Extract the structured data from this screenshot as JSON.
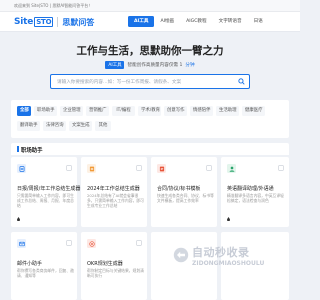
{
  "topbar": {
    "welcome": "欢迎来到 Site|STO | 思默AI智能问答平台！"
  },
  "brand": {
    "logo_en_1": "Site",
    "logo_en_2": "STO",
    "logo_cn": "思默问答"
  },
  "nav": {
    "items": [
      {
        "label": "AI工具",
        "active": true
      },
      {
        "label": "AI绘画",
        "active": false
      },
      {
        "label": "AIGC教程",
        "active": false
      },
      {
        "label": "文字转语音",
        "active": false
      },
      {
        "label": "日语",
        "active": false
      }
    ]
  },
  "hero": {
    "title": "工作与生活，思默助你一臂之力",
    "tag": "AI工具",
    "subtitle": "智能创作高质量内容仅需 1",
    "subtitle_link": "分钟"
  },
  "search": {
    "placeholder": "请输入你要搜索的内容…如：写一份工作周报、请假条、文案"
  },
  "categories": [
    {
      "label": "全部",
      "active": true
    },
    {
      "label": "职场助手",
      "active": false
    },
    {
      "label": "企业管理",
      "active": false
    },
    {
      "label": "营销推广",
      "active": false
    },
    {
      "label": "IT/编程",
      "active": false
    },
    {
      "label": "学术/教育",
      "active": false
    },
    {
      "label": "创意写作",
      "active": false
    },
    {
      "label": "情感陪伴",
      "active": false
    },
    {
      "label": "生活助理",
      "active": false
    },
    {
      "label": "健康医疗",
      "active": false
    },
    {
      "label": "翻译助手",
      "active": false
    },
    {
      "label": "法律咨询",
      "active": false
    },
    {
      "label": "文案生成",
      "active": false
    },
    {
      "label": "其他",
      "active": false
    }
  ],
  "section": {
    "title": "职场助手"
  },
  "cards": [
    {
      "name": "日报/周报/年工作总结生成器",
      "desc": "只需要简单输入工作内容，即可生成工作总结、周报、月报、年度总结",
      "icon": "report-icon",
      "color": "#1a73e8"
    },
    {
      "name": "2024年工作总结生成器",
      "desc": "2024年总结有了AI就会省事很多，只需简单输入工作内容，即可生成专业工作总结",
      "icon": "document-icon",
      "color": "#f29b38"
    },
    {
      "name": "合同/协议/标书模板",
      "desc": "快速生成各类合同、协议、标书等文件模板，提高工作效率",
      "icon": "contract-icon",
      "color": "#e8553a"
    },
    {
      "name": "英语翻译助理/外语通",
      "desc": "精准翻译多语言内容，中英互译轻松搞定，语法检查与润色",
      "icon": "person-icon",
      "color": "#2aa46b"
    },
    {
      "name": "邮件小助手",
      "desc": "帮你撰写各类商务邮件，回复、邀请、通知等",
      "icon": "mail-icon",
      "color": "#1a73e8"
    },
    {
      "name": "OKR规划生成器",
      "desc": "帮你制定目标与关键结果，规划清晰可执行",
      "icon": "target-icon",
      "color": "#e8553a"
    }
  ],
  "watermark": {
    "big": "自动秒收录",
    "small": "ZIDONGMIAOSHOULU"
  }
}
